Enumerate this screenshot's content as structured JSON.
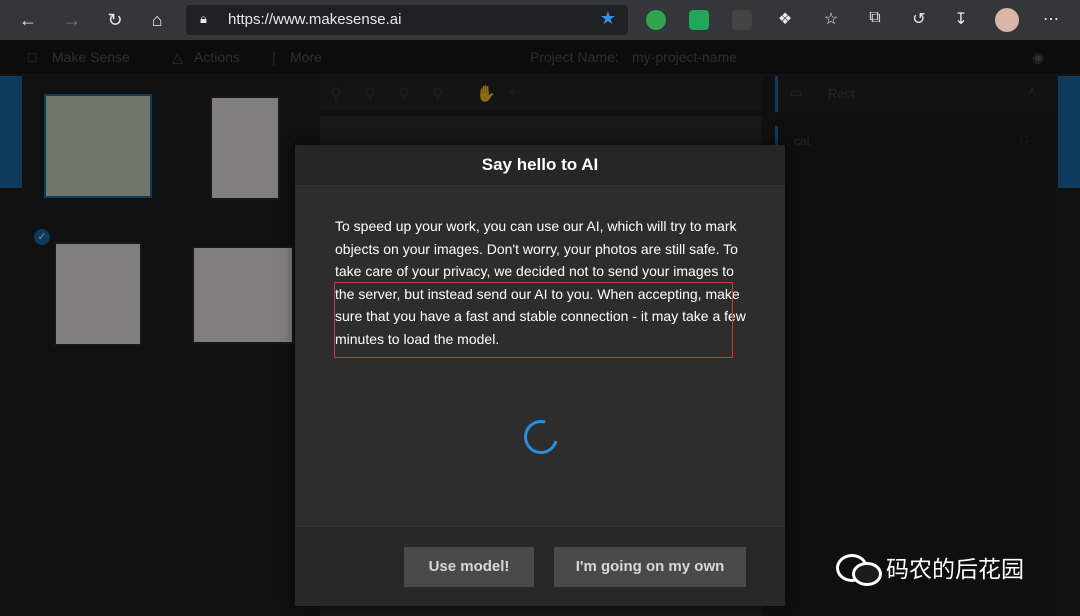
{
  "browser": {
    "url": "https://www.makesense.ai"
  },
  "app_header": {
    "brand": "Make Sense",
    "actions": "Actions",
    "more": "More",
    "project_name_label": "Project Name:",
    "project_name_value": "my-project-name"
  },
  "right_panel": {
    "header_label": "Rect",
    "row_label": "cat"
  },
  "modal": {
    "title": "Say hello to AI",
    "body": "To speed up your work, you can use our AI, which will try to mark objects on your images. Don't worry, your photos are still safe. To take care of your privacy, we decided not to send your images to the server, but instead send our AI to you. When accepting, make sure that you have a fast and stable connection - it may take a few minutes to load the model.",
    "use_model_button": "Use model!",
    "own_button": "I'm going on my own"
  },
  "watermark": {
    "text": "码农的后花园"
  },
  "colors": {
    "accent": "#1b6ca8",
    "highlight_border": "#d23b3b",
    "spinner": "#2a8fe0"
  }
}
